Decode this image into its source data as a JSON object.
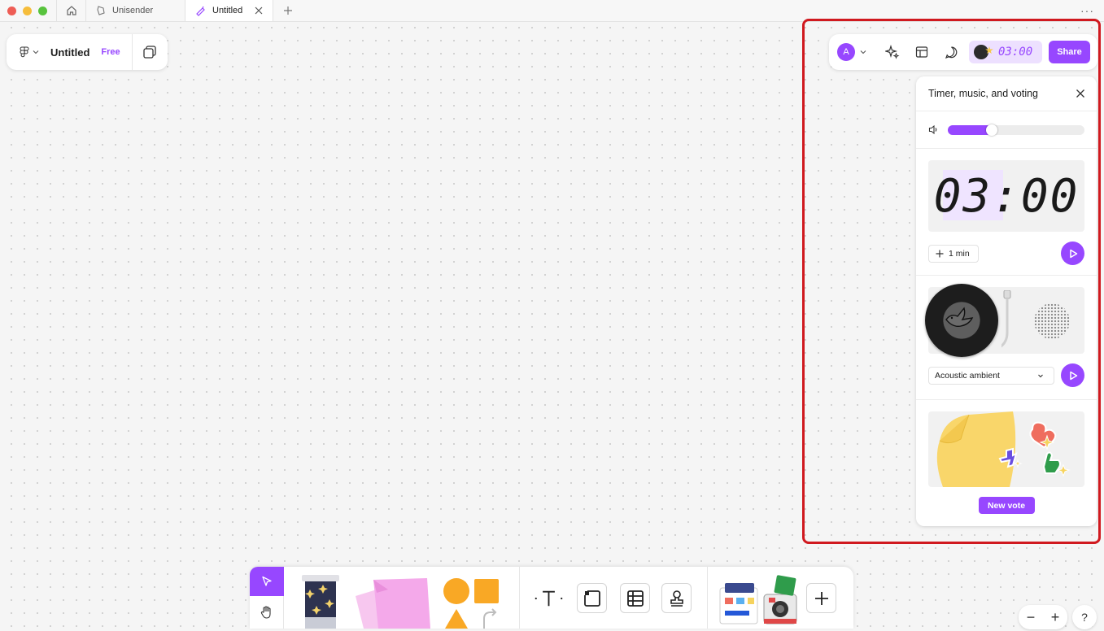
{
  "titlebar": {
    "tabs": [
      {
        "label": "Unisender"
      },
      {
        "label": "Untitled"
      }
    ],
    "more": "···"
  },
  "file": {
    "title": "Untitled",
    "plan": "Free"
  },
  "toolbar": {
    "avatar_initial": "A",
    "timer_display": "03:00",
    "share_label": "Share"
  },
  "panel": {
    "title": "Timer, music, and voting",
    "volume_percent": 32,
    "timer": {
      "display": "03:00",
      "add_label": "1 min"
    },
    "music": {
      "selected_track": "Acoustic ambient"
    },
    "vote": {
      "button_label": "New vote"
    }
  },
  "zoom": {
    "minus": "−",
    "plus": "+"
  },
  "help": "?",
  "colors": {
    "accent": "#9747ff",
    "highlight": "#d0191f"
  }
}
